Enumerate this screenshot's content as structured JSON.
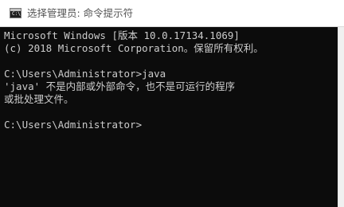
{
  "window": {
    "title": "选择管理员: 命令提示符",
    "icon": "cmd-console-icon",
    "icon_prompt": "C:\\"
  },
  "console": {
    "background": "#0c0c0c",
    "foreground": "#cccccc",
    "lines": [
      "Microsoft Windows [版本 10.0.17134.1069]",
      "(c) 2018 Microsoft Corporation。保留所有权利。",
      "",
      "C:\\Users\\Administrator>java",
      "'java' 不是内部或外部命令，也不是可运行的程序",
      "或批处理文件。",
      "",
      "C:\\Users\\Administrator>"
    ]
  }
}
